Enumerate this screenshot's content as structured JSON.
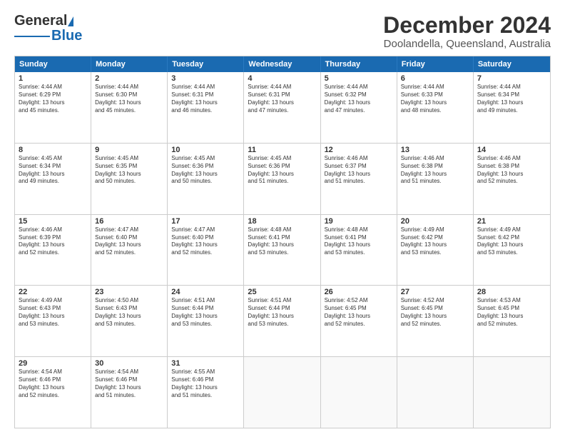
{
  "logo": {
    "general": "General",
    "blue": "Blue"
  },
  "title": "December 2024",
  "location": "Doolandella, Queensland, Australia",
  "days": [
    "Sunday",
    "Monday",
    "Tuesday",
    "Wednesday",
    "Thursday",
    "Friday",
    "Saturday"
  ],
  "weeks": [
    [
      {
        "day": "1",
        "lines": [
          "Sunrise: 4:44 AM",
          "Sunset: 6:29 PM",
          "Daylight: 13 hours",
          "and 45 minutes."
        ]
      },
      {
        "day": "2",
        "lines": [
          "Sunrise: 4:44 AM",
          "Sunset: 6:30 PM",
          "Daylight: 13 hours",
          "and 45 minutes."
        ]
      },
      {
        "day": "3",
        "lines": [
          "Sunrise: 4:44 AM",
          "Sunset: 6:31 PM",
          "Daylight: 13 hours",
          "and 46 minutes."
        ]
      },
      {
        "day": "4",
        "lines": [
          "Sunrise: 4:44 AM",
          "Sunset: 6:31 PM",
          "Daylight: 13 hours",
          "and 47 minutes."
        ]
      },
      {
        "day": "5",
        "lines": [
          "Sunrise: 4:44 AM",
          "Sunset: 6:32 PM",
          "Daylight: 13 hours",
          "and 47 minutes."
        ]
      },
      {
        "day": "6",
        "lines": [
          "Sunrise: 4:44 AM",
          "Sunset: 6:33 PM",
          "Daylight: 13 hours",
          "and 48 minutes."
        ]
      },
      {
        "day": "7",
        "lines": [
          "Sunrise: 4:44 AM",
          "Sunset: 6:34 PM",
          "Daylight: 13 hours",
          "and 49 minutes."
        ]
      }
    ],
    [
      {
        "day": "8",
        "lines": [
          "Sunrise: 4:45 AM",
          "Sunset: 6:34 PM",
          "Daylight: 13 hours",
          "and 49 minutes."
        ]
      },
      {
        "day": "9",
        "lines": [
          "Sunrise: 4:45 AM",
          "Sunset: 6:35 PM",
          "Daylight: 13 hours",
          "and 50 minutes."
        ]
      },
      {
        "day": "10",
        "lines": [
          "Sunrise: 4:45 AM",
          "Sunset: 6:36 PM",
          "Daylight: 13 hours",
          "and 50 minutes."
        ]
      },
      {
        "day": "11",
        "lines": [
          "Sunrise: 4:45 AM",
          "Sunset: 6:36 PM",
          "Daylight: 13 hours",
          "and 51 minutes."
        ]
      },
      {
        "day": "12",
        "lines": [
          "Sunrise: 4:46 AM",
          "Sunset: 6:37 PM",
          "Daylight: 13 hours",
          "and 51 minutes."
        ]
      },
      {
        "day": "13",
        "lines": [
          "Sunrise: 4:46 AM",
          "Sunset: 6:38 PM",
          "Daylight: 13 hours",
          "and 51 minutes."
        ]
      },
      {
        "day": "14",
        "lines": [
          "Sunrise: 4:46 AM",
          "Sunset: 6:38 PM",
          "Daylight: 13 hours",
          "and 52 minutes."
        ]
      }
    ],
    [
      {
        "day": "15",
        "lines": [
          "Sunrise: 4:46 AM",
          "Sunset: 6:39 PM",
          "Daylight: 13 hours",
          "and 52 minutes."
        ]
      },
      {
        "day": "16",
        "lines": [
          "Sunrise: 4:47 AM",
          "Sunset: 6:40 PM",
          "Daylight: 13 hours",
          "and 52 minutes."
        ]
      },
      {
        "day": "17",
        "lines": [
          "Sunrise: 4:47 AM",
          "Sunset: 6:40 PM",
          "Daylight: 13 hours",
          "and 52 minutes."
        ]
      },
      {
        "day": "18",
        "lines": [
          "Sunrise: 4:48 AM",
          "Sunset: 6:41 PM",
          "Daylight: 13 hours",
          "and 53 minutes."
        ]
      },
      {
        "day": "19",
        "lines": [
          "Sunrise: 4:48 AM",
          "Sunset: 6:41 PM",
          "Daylight: 13 hours",
          "and 53 minutes."
        ]
      },
      {
        "day": "20",
        "lines": [
          "Sunrise: 4:49 AM",
          "Sunset: 6:42 PM",
          "Daylight: 13 hours",
          "and 53 minutes."
        ]
      },
      {
        "day": "21",
        "lines": [
          "Sunrise: 4:49 AM",
          "Sunset: 6:42 PM",
          "Daylight: 13 hours",
          "and 53 minutes."
        ]
      }
    ],
    [
      {
        "day": "22",
        "lines": [
          "Sunrise: 4:49 AM",
          "Sunset: 6:43 PM",
          "Daylight: 13 hours",
          "and 53 minutes."
        ]
      },
      {
        "day": "23",
        "lines": [
          "Sunrise: 4:50 AM",
          "Sunset: 6:43 PM",
          "Daylight: 13 hours",
          "and 53 minutes."
        ]
      },
      {
        "day": "24",
        "lines": [
          "Sunrise: 4:51 AM",
          "Sunset: 6:44 PM",
          "Daylight: 13 hours",
          "and 53 minutes."
        ]
      },
      {
        "day": "25",
        "lines": [
          "Sunrise: 4:51 AM",
          "Sunset: 6:44 PM",
          "Daylight: 13 hours",
          "and 53 minutes."
        ]
      },
      {
        "day": "26",
        "lines": [
          "Sunrise: 4:52 AM",
          "Sunset: 6:45 PM",
          "Daylight: 13 hours",
          "and 52 minutes."
        ]
      },
      {
        "day": "27",
        "lines": [
          "Sunrise: 4:52 AM",
          "Sunset: 6:45 PM",
          "Daylight: 13 hours",
          "and 52 minutes."
        ]
      },
      {
        "day": "28",
        "lines": [
          "Sunrise: 4:53 AM",
          "Sunset: 6:45 PM",
          "Daylight: 13 hours",
          "and 52 minutes."
        ]
      }
    ],
    [
      {
        "day": "29",
        "lines": [
          "Sunrise: 4:54 AM",
          "Sunset: 6:46 PM",
          "Daylight: 13 hours",
          "and 52 minutes."
        ]
      },
      {
        "day": "30",
        "lines": [
          "Sunrise: 4:54 AM",
          "Sunset: 6:46 PM",
          "Daylight: 13 hours",
          "and 51 minutes."
        ]
      },
      {
        "day": "31",
        "lines": [
          "Sunrise: 4:55 AM",
          "Sunset: 6:46 PM",
          "Daylight: 13 hours",
          "and 51 minutes."
        ]
      },
      null,
      null,
      null,
      null
    ]
  ]
}
